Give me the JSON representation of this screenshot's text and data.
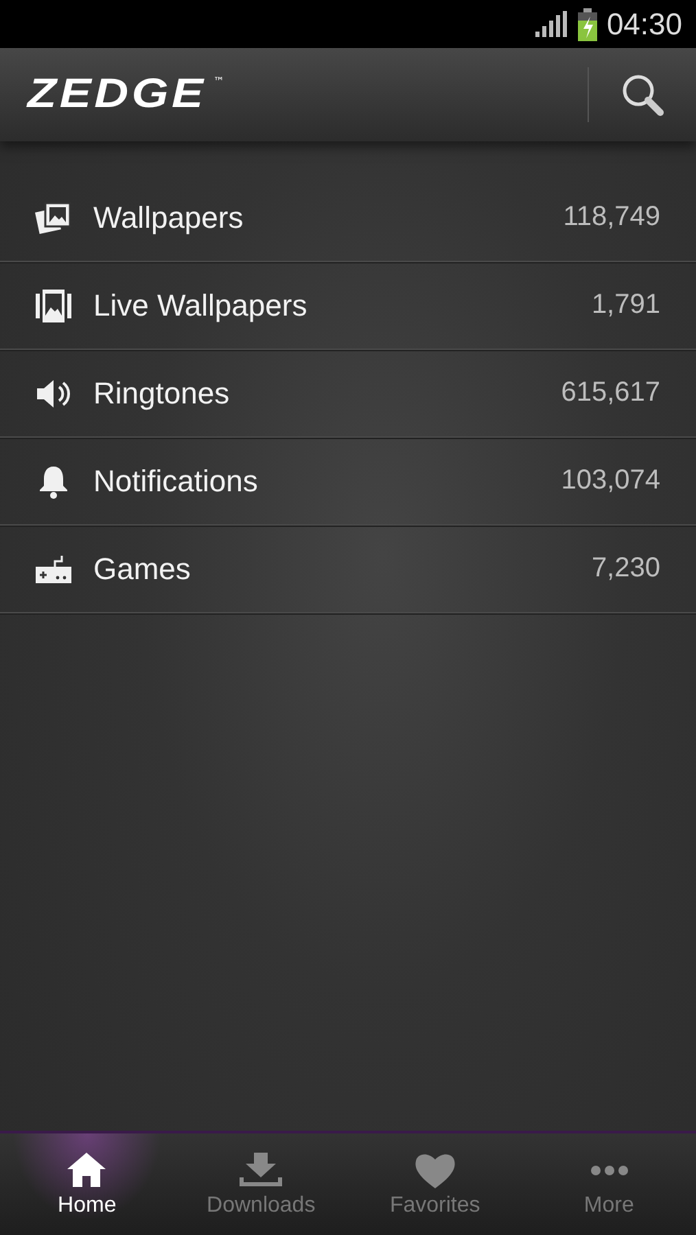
{
  "status_bar": {
    "time": "04:30"
  },
  "action_bar": {
    "logo": "ZEDGE",
    "trademark": "™"
  },
  "categories": [
    {
      "kind": "wallpapers",
      "label": "Wallpapers",
      "count": "118,749"
    },
    {
      "kind": "live",
      "label": "Live Wallpapers",
      "count": "1,791"
    },
    {
      "kind": "ringtones",
      "label": "Ringtones",
      "count": "615,617"
    },
    {
      "kind": "notifications",
      "label": "Notifications",
      "count": "103,074"
    },
    {
      "kind": "games",
      "label": "Games",
      "count": "7,230"
    }
  ],
  "nav": [
    {
      "kind": "home",
      "label": "Home",
      "selected": true
    },
    {
      "kind": "downloads",
      "label": "Downloads",
      "selected": false
    },
    {
      "kind": "favorites",
      "label": "Favorites",
      "selected": false
    },
    {
      "kind": "more",
      "label": "More",
      "selected": false
    }
  ]
}
